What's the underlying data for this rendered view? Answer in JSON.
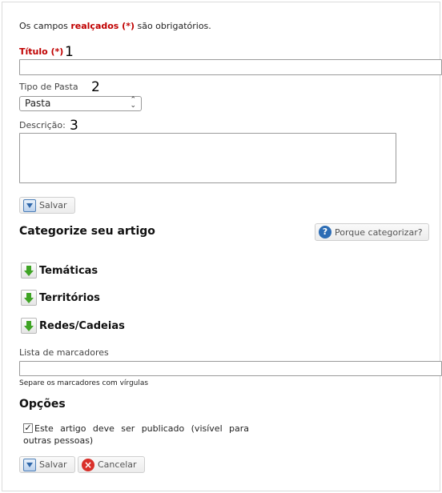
{
  "required_note": {
    "before": "Os campos ",
    "highlight": "realçados (*)",
    "after": " são obrigatórios."
  },
  "fields": {
    "title": {
      "label": "Título (*)",
      "marker": "1",
      "value": ""
    },
    "folder_type": {
      "label": "Tipo de Pasta",
      "marker": "2",
      "selected": "Pasta"
    },
    "description": {
      "label": "Descrição:",
      "marker": "3",
      "value": ""
    }
  },
  "save_label": "Salvar",
  "categorize": {
    "heading": "Categorize seu artigo",
    "help_button": "Porque categorizar?",
    "categories": [
      "Temáticas",
      "Territórios",
      "Redes/Cadeias"
    ]
  },
  "tags": {
    "label": "Lista de marcadores",
    "value": "",
    "hint": "Separe os marcadores com vírgulas"
  },
  "options": {
    "heading": "Opções",
    "publish_checked": true,
    "publish_label": "Este artigo deve ser publicado (visível para outras pessoas)"
  },
  "footer": {
    "save_label": "Salvar",
    "cancel_label": "Cancelar"
  }
}
